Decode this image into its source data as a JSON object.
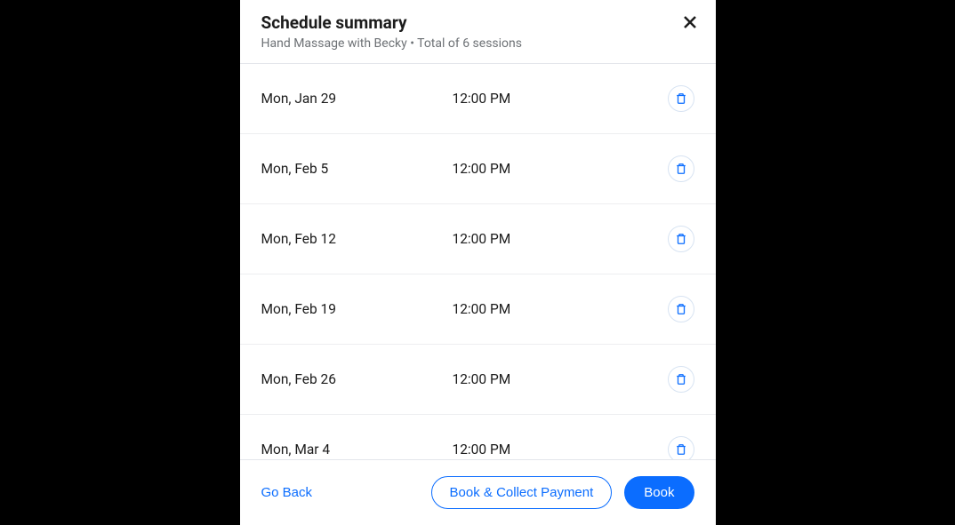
{
  "header": {
    "title": "Schedule summary",
    "subtitle": "Hand Massage with Becky • Total of 6 sessions"
  },
  "sessions": [
    {
      "date": "Mon, Jan 29",
      "time": "12:00 PM"
    },
    {
      "date": "Mon, Feb 5",
      "time": "12:00 PM"
    },
    {
      "date": "Mon, Feb 12",
      "time": "12:00 PM"
    },
    {
      "date": "Mon, Feb 19",
      "time": "12:00 PM"
    },
    {
      "date": "Mon, Feb 26",
      "time": "12:00 PM"
    },
    {
      "date": "Mon, Mar 4",
      "time": "12:00 PM"
    }
  ],
  "footer": {
    "go_back": "Go Back",
    "book_collect": "Book & Collect Payment",
    "book": "Book"
  }
}
